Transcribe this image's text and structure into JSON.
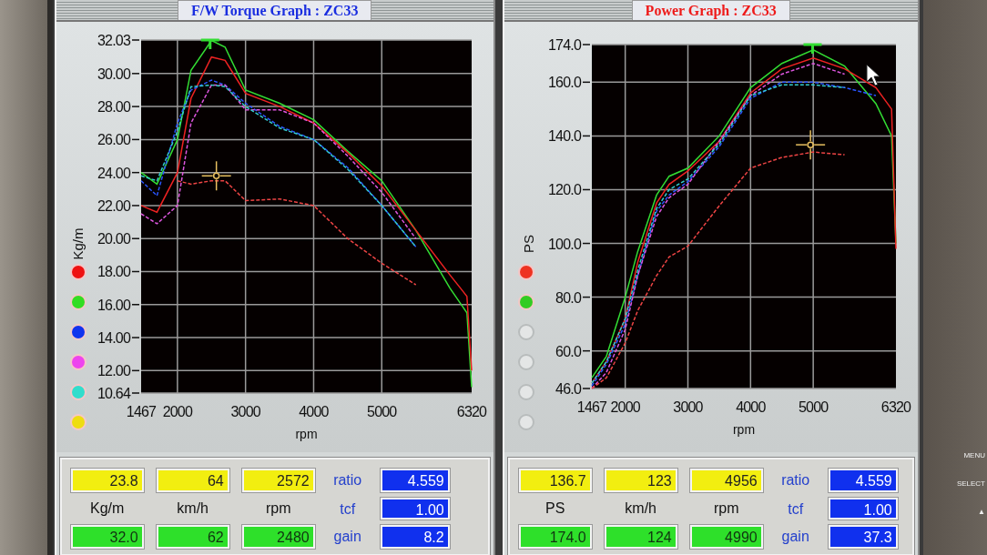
{
  "panels": [
    {
      "title": "F/W Torque Graph : ZC33",
      "chart_data": {
        "type": "line",
        "xlabel": "rpm",
        "ylabel": "Kg/m",
        "grid": true,
        "x": [
          1467,
          1700,
          2000,
          2200,
          2500,
          2700,
          3000,
          3500,
          4000,
          4500,
          5000,
          5500,
          6000,
          6250,
          6320
        ],
        "xlim": [
          1467,
          6320
        ],
        "ylim": [
          10.64,
          32.03
        ],
        "xticks": [
          1467,
          2000,
          3000,
          4000,
          5000,
          6320
        ],
        "yticks": [
          {
            "value": 10.64,
            "label": "10.64"
          },
          {
            "value": 12,
            "label": "12.00"
          },
          {
            "value": 14,
            "label": "14.00"
          },
          {
            "value": 16,
            "label": "16.00"
          },
          {
            "value": 18,
            "label": "18.00"
          },
          {
            "value": 20,
            "label": "20.00"
          },
          {
            "value": 22,
            "label": "22.00"
          },
          {
            "value": 24,
            "label": "24.00"
          },
          {
            "value": 26,
            "label": "26.00"
          },
          {
            "value": 28,
            "label": "28.00"
          },
          {
            "value": 30,
            "label": "30.00"
          },
          {
            "value": 32.03,
            "label": "32.03"
          }
        ],
        "series": [
          {
            "color": "#33dd33",
            "line_style": "solid",
            "values": [
              24.0,
              23.3,
              26.0,
              30.2,
              32.0,
              31.6,
              29.0,
              28.2,
              27.2,
              25.3,
              23.5,
              20.5,
              17.0,
              15.5,
              11.0
            ]
          },
          {
            "color": "#ee2222",
            "line_style": "solid",
            "values": [
              22.0,
              21.6,
              24.0,
              28.5,
              31.0,
              30.8,
              28.8,
              28.0,
              27.0,
              25.2,
              23.2,
              20.5,
              17.8,
              16.5,
              12.0
            ]
          },
          {
            "color": "#2a55ff",
            "line_style": "dashed",
            "values": [
              23.5,
              22.6,
              27.0,
              29.0,
              29.6,
              29.3,
              28.2,
              26.8,
              26.0,
              24.3,
              22.0,
              19.5,
              null,
              null,
              null
            ]
          },
          {
            "color": "#dd55dd",
            "line_style": "dashed",
            "values": [
              21.5,
              20.9,
              22.0,
              27.0,
              29.3,
              29.3,
              27.8,
              27.8,
              27.0,
              25.0,
              22.8,
              20.0,
              null,
              null,
              null
            ]
          },
          {
            "color": "#33cccc",
            "line_style": "dashed",
            "values": [
              23.8,
              23.5,
              26.5,
              29.2,
              29.3,
              29.2,
              28.0,
              26.7,
              26.0,
              24.2,
              22.0,
              19.5,
              null,
              null,
              null
            ]
          },
          {
            "color": "#ee4444",
            "line_style": "dashed",
            "values": [
              null,
              null,
              23.5,
              23.3,
              23.5,
              23.5,
              22.3,
              22.4,
              22.0,
              20.0,
              18.5,
              17.2,
              null,
              null,
              null
            ]
          }
        ]
      },
      "legend": [
        {
          "color": "#ee1111",
          "on": true
        },
        {
          "color": "#33dd22",
          "on": true
        },
        {
          "color": "#1133ee",
          "on": true
        },
        {
          "color": "#ee44ee",
          "on": true
        },
        {
          "color": "#33ddcc",
          "on": true
        },
        {
          "color": "#eedd11",
          "on": true
        }
      ],
      "readouts": {
        "current": [
          "23.8",
          "64",
          "2572"
        ],
        "units": [
          "Kg/m",
          "km/h",
          "rpm"
        ],
        "peak": [
          "32.0",
          "62",
          "2480"
        ],
        "params": [
          {
            "label": "ratio",
            "value": "4.559"
          },
          {
            "label": "tcf",
            "value": "1.00"
          },
          {
            "label": "gain",
            "value": "8.2"
          }
        ]
      }
    },
    {
      "title": "Power Graph : ZC33",
      "chart_data": {
        "type": "line",
        "xlabel": "rpm",
        "ylabel": "PS",
        "grid": true,
        "x": [
          1467,
          1700,
          2000,
          2200,
          2500,
          2700,
          3000,
          3500,
          4000,
          4500,
          5000,
          5500,
          6000,
          6250,
          6320
        ],
        "xlim": [
          1467,
          6320
        ],
        "ylim": [
          46,
          174
        ],
        "xticks": [
          1467,
          2000,
          3000,
          4000,
          5000,
          6320
        ],
        "yticks": [
          {
            "value": 46,
            "label": "46.0"
          },
          {
            "value": 60,
            "label": "60.0"
          },
          {
            "value": 80,
            "label": "80.0"
          },
          {
            "value": 100,
            "label": "100.0"
          },
          {
            "value": 120,
            "label": "120.0"
          },
          {
            "value": 140,
            "label": "140.0"
          },
          {
            "value": 160,
            "label": "160.0"
          },
          {
            "value": 174,
            "label": "174.0"
          }
        ],
        "series": [
          {
            "color": "#33dd33",
            "line_style": "solid",
            "values": [
              50,
              58,
              80,
              97,
              118,
              125,
              128,
              140,
              158,
              167,
              172,
              166,
              152,
              140,
              100
            ]
          },
          {
            "color": "#ee2222",
            "line_style": "solid",
            "values": [
              48,
              56,
              72,
              93,
              115,
              122,
              127,
              138,
              156,
              165,
              169,
              165,
              158,
              150,
              98
            ]
          },
          {
            "color": "#2a55ff",
            "line_style": "dashed",
            "values": [
              47,
              55,
              70,
              88,
              112,
              118,
              123,
              136,
              154,
              160,
              160,
              158,
              155,
              null,
              null
            ]
          },
          {
            "color": "#dd55dd",
            "line_style": "dashed",
            "values": [
              46,
              52,
              68,
              88,
              110,
              117,
              122,
              138,
              155,
              163,
              167,
              163,
              null,
              null,
              null
            ]
          },
          {
            "color": "#33cccc",
            "line_style": "dashed",
            "values": [
              48,
              56,
              72,
              90,
              113,
              120,
              124,
              137,
              155,
              159,
              159,
              158,
              null,
              null,
              null
            ]
          },
          {
            "color": "#ee4444",
            "line_style": "dashed",
            "values": [
              46,
              50,
              63,
              75,
              88,
              95,
              99,
              114,
              128,
              132,
              134,
              133,
              null,
              null,
              null
            ]
          }
        ]
      },
      "legend": [
        {
          "color": "#ee3322",
          "on": true
        },
        {
          "color": "#33cc22",
          "on": true
        },
        {
          "on": false
        },
        {
          "on": false
        },
        {
          "on": false
        },
        {
          "on": false
        }
      ],
      "readouts": {
        "current": [
          "136.7",
          "123",
          "4956"
        ],
        "units": [
          "PS",
          "km/h",
          "rpm"
        ],
        "peak": [
          "174.0",
          "124",
          "4990"
        ],
        "params": [
          {
            "label": "ratio",
            "value": "4.559"
          },
          {
            "label": "tcf",
            "value": "1.00"
          },
          {
            "label": "gain",
            "value": "37.3"
          }
        ]
      }
    }
  ],
  "bezel": {
    "buttons": [
      "MENU",
      "SELECT",
      "▲"
    ]
  }
}
